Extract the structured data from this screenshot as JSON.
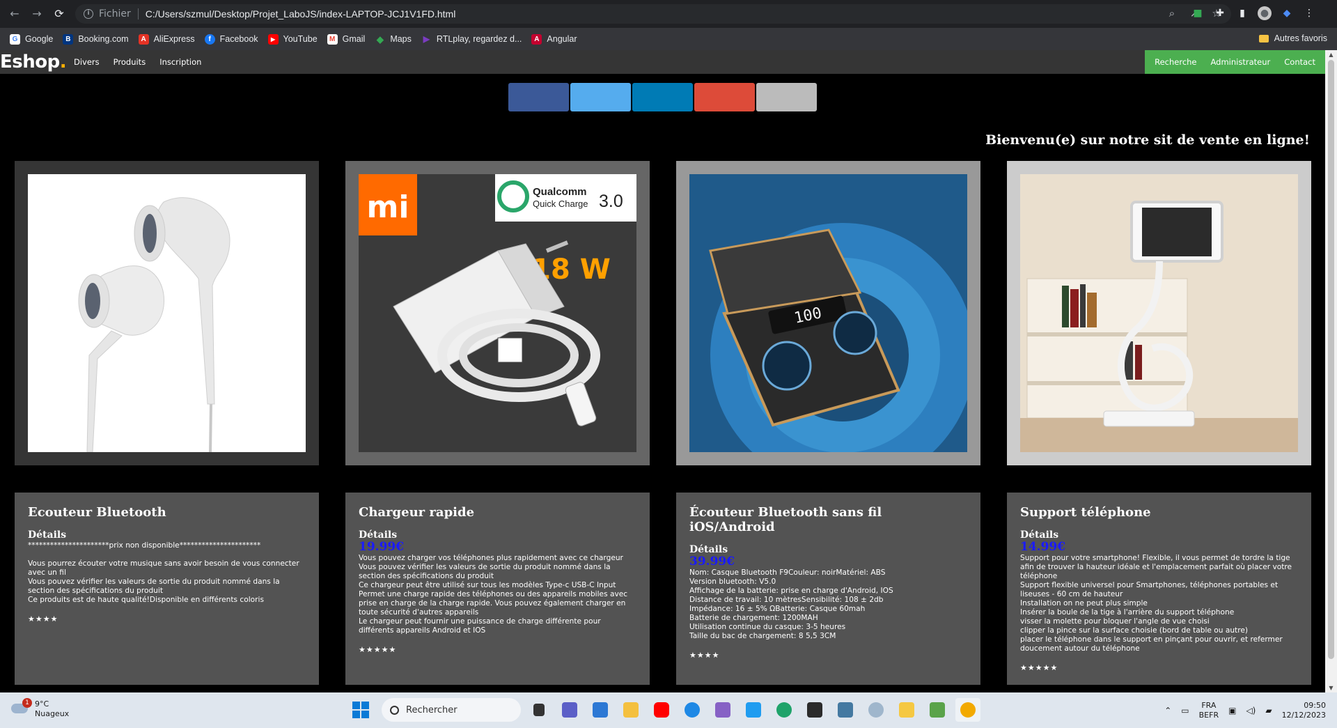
{
  "browser": {
    "scheme_label": "Fichier",
    "url": "C:/Users/szmul/Desktop/Projet_LaboJS/index-LAPTOP-JCJ1V1FD.html",
    "bookmarks": [
      {
        "label": "Google",
        "color": "#4285f4",
        "glyph": "G"
      },
      {
        "label": "Booking.com",
        "color": "#003580",
        "glyph": "B"
      },
      {
        "label": "AliExpress",
        "color": "#e43225",
        "glyph": "A"
      },
      {
        "label": "Facebook",
        "color": "#1877f2",
        "glyph": "f"
      },
      {
        "label": "YouTube",
        "color": "#ff0000",
        "glyph": "▶"
      },
      {
        "label": "Gmail",
        "color": "#ea4335",
        "glyph": "M"
      },
      {
        "label": "Maps",
        "color": "#34a853",
        "glyph": "◆"
      },
      {
        "label": "RTLplay, regardez d...",
        "color": "#7a3cc0",
        "glyph": "▶"
      },
      {
        "label": "Angular",
        "color": "#c3002f",
        "glyph": "A"
      }
    ],
    "other_bookmarks": "Autres favoris"
  },
  "site": {
    "brand": "Eshop",
    "brand_dot": ".",
    "nav_left": [
      "Divers",
      "Produits",
      "Inscription"
    ],
    "nav_right": [
      "Recherche",
      "Administrateur",
      "Contact"
    ],
    "social_colors": [
      "#3b5998",
      "#55acee",
      "#007bb5",
      "#dd4b39",
      "#bbbbbb"
    ],
    "welcome": "Bienvenu(e) sur notre sit de vente en ligne!"
  },
  "products": [
    {
      "title": "Ecouteur Bluetooth",
      "details_label": "Détails",
      "price": "",
      "description": "**********************prix non disponible**********************\n\nVous pourrez écouter votre musique sans avoir besoin de vous connecter avec un fil\nVous pouvez vérifier les valeurs de sortie du produit nommé dans la section des spécifications du produit\nCe produits est de haute qualité!Disponible en différents coloris",
      "stars": "★★★★",
      "frame_color": "#353535"
    },
    {
      "title": "Chargeur rapide",
      "details_label": "Détails",
      "price": "19.99€",
      "description": "Vous pouvez charger vos téléphones plus rapidement avec ce chargeur\nVous pouvez vérifier les valeurs de sortie du produit nommé dans la section des spécifications du produit\nCe chargeur peut être utilisé sur tous les modèles Type-c USB-C Input\nPermet une charge rapide des téléphones ou des appareils mobiles avec prise en charge de la charge rapide. Vous pouvez également charger en toute sécurité d'autres appareils\nLe chargeur peut fournir une puissance de charge différente pour différents appareils Android et IOS",
      "stars": "★★★★★",
      "frame_color": "#666666",
      "brand_logo_text": "mi",
      "badge_text_1": "Qualcomm",
      "badge_text_2": "Quick Charge",
      "badge_version": "3.0",
      "watt_label": "18 W"
    },
    {
      "title": "Écouteur Bluetooth sans fil iOS/Android",
      "details_label": "Détails",
      "price": "39.99€",
      "description": "Nom: Casque Bluetooth F9Couleur: noirMatériel: ABS\nVersion bluetooth: V5.0\nAffichage de la batterie: prise en charge d'Android, IOS\nDistance de travail: 10 mètresSensibilité: 108 ± 2db\nImpédance: 16 ± 5% ΩBatterie: Casque 60mah\nBatterie de chargement: 1200MAH\nUtilisation continue du casque: 3-5 heures\nTaille du bac de chargement: 8 5,5 3CM",
      "stars": "★★★★",
      "frame_color": "#999999",
      "display_text": "100"
    },
    {
      "title": "Support téléphone",
      "details_label": "Détails",
      "price": "14.99€",
      "description": "Support pour votre smartphone! Flexible, il vous permet de tordre la tige afin de trouver la hauteur idéale et l'emplacement parfait où placer votre téléphone\nSupport flexible universel pour Smartphones, téléphones portables et liseuses - 60 cm de hauteur\nInstallation on ne peut plus simple\nInsérer la boule de la tige à l'arrière du support téléphone\nvisser la molette pour bloquer l'angle de vue choisi\nclipper la pince sur la surface choisie (bord de table ou autre)\nplacer le téléphone dans le support en pinçant pour ouvrir, et refermer doucement autour du téléphone",
      "stars": "★★★★★",
      "frame_color": "#cccccc"
    }
  ],
  "taskbar": {
    "weather_temp": "9°C",
    "weather_desc": "Nuageux",
    "weather_badge": "1",
    "search_placeholder": "Rechercher",
    "lang_1": "FRA",
    "lang_2": "BEFR",
    "time": "09:50",
    "date": "12/12/2023"
  }
}
